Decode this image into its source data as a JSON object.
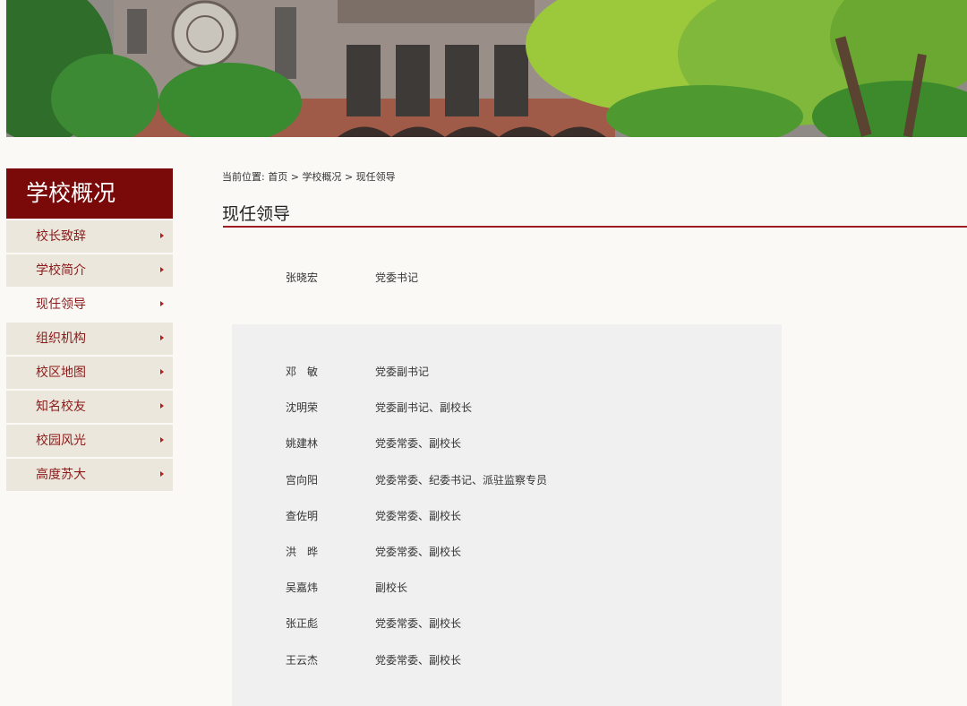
{
  "sidebar": {
    "title": "学校概况",
    "items": [
      {
        "label": "校长致辞",
        "active": false
      },
      {
        "label": "学校简介",
        "active": false
      },
      {
        "label": "现任领导",
        "active": true
      },
      {
        "label": "组织机构",
        "active": false
      },
      {
        "label": "校区地图",
        "active": false
      },
      {
        "label": "知名校友",
        "active": false
      },
      {
        "label": "校园风光",
        "active": false
      },
      {
        "label": "高度苏大",
        "active": false
      }
    ]
  },
  "breadcrumb": {
    "prefix": "当前位置:",
    "home": "首页",
    "sep": ">",
    "section": "学校概况",
    "current": "现任领导"
  },
  "page": {
    "title": "现任领导"
  },
  "leaders": {
    "secretary": {
      "name": "张晓宏",
      "role": "党委书记"
    },
    "others": [
      {
        "name": "邓　敏",
        "role": "党委副书记"
      },
      {
        "name": "沈明荣",
        "role": "党委副书记、副校长"
      },
      {
        "name": "姚建林",
        "role": "党委常委、副校长"
      },
      {
        "name": "宫向阳",
        "role": "党委常委、纪委书记、派驻监察专员"
      },
      {
        "name": "查佐明",
        "role": "党委常委、副校长"
      },
      {
        "name": "洪　晔",
        "role": "党委常委、副校长"
      },
      {
        "name": "吴嘉炜",
        "role": "副校长"
      },
      {
        "name": "张正彪",
        "role": "党委常委、副校长"
      },
      {
        "name": "王云杰",
        "role": "党委常委、副校长"
      }
    ]
  },
  "colors": {
    "accent": "#7a0a0a",
    "rule": "#9c1c22",
    "menu_bg": "#ece7dc",
    "menu_text": "#8b1a1a"
  }
}
